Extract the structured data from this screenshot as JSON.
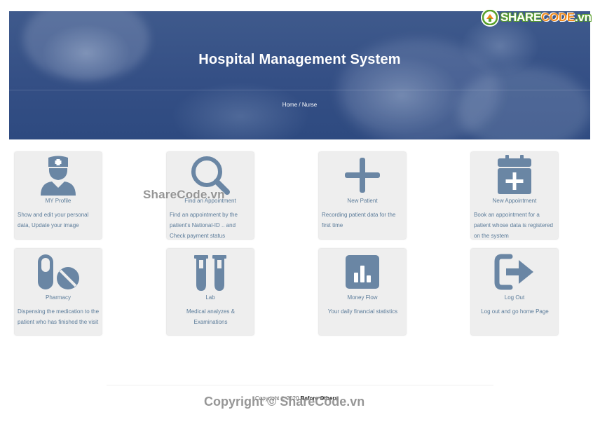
{
  "header": {
    "title": "Hospital Management System",
    "breadcrumb_home": "Home",
    "breadcrumb_sep": "/",
    "breadcrumb_current": "Nurse"
  },
  "logo": {
    "part1": "SHARE",
    "part2": "CODE",
    "part3": ".vn"
  },
  "cards": [
    {
      "icon": "nurse-icon",
      "label": "MY Profile",
      "desc": "Show and edit your personal data, Update your image"
    },
    {
      "icon": "search-icon",
      "label": "Find an Appointment",
      "desc": "Find an appointment by the patient's National-ID .. and Check payment status"
    },
    {
      "icon": "plus-icon",
      "label": "New Patient",
      "desc": "Recording patient data for the first time"
    },
    {
      "icon": "calendar-plus-icon",
      "label": "New Appointment",
      "desc": "Book an appointment for a patient whose data is registered on the system"
    },
    {
      "icon": "pills-icon",
      "label": "Pharmacy",
      "desc": "Dispensing the medication to the patient who has finished the visit"
    },
    {
      "icon": "test-tubes-icon",
      "label": "Lab",
      "desc": "Medical analyzes & Examinations"
    },
    {
      "icon": "bar-chart-icon",
      "label": "Money Flow",
      "desc": "Your daily financial statistics"
    },
    {
      "icon": "sign-out-icon",
      "label": "Log Out",
      "desc": "Log out and go home Page"
    }
  ],
  "footer": {
    "text": "Copyright © 2020",
    "brand": "Before Others"
  },
  "watermarks": {
    "top": "ShareCode.vn",
    "bottom": "Copyright © ShareCode.vn"
  },
  "colors": {
    "hero": "#344f85",
    "icon": "#6a86a4",
    "card": "#eeeeee",
    "text": "#5c7c9a"
  }
}
